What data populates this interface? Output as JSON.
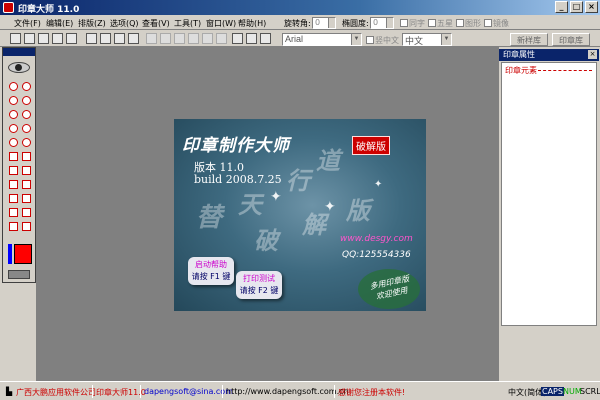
{
  "window": {
    "title": "印章大师 11.0",
    "buttons": [
      "_",
      "□",
      "×"
    ]
  },
  "menu": {
    "items": [
      "文件(F)",
      "编辑(E)",
      "排版(Z)",
      "选项(Q)",
      "查看(V)",
      "工具(T)",
      "窗口(W)",
      "帮助(H)"
    ],
    "rotation_label": "旋转角:",
    "rotation_value": "0",
    "ellipse_label": "椭圆度:",
    "ellipse_value": "0",
    "checkboxes": [
      "同字",
      "五星",
      "图形",
      "镜像"
    ]
  },
  "toolbar": {
    "font_value": "Arial",
    "font_checkbox": "竖中文",
    "lang_value": "中文",
    "panel_tabs": [
      "新样库",
      "印章库"
    ]
  },
  "right_panel": {
    "header": "印章属性",
    "close": "×",
    "title": "印章元素"
  },
  "splash": {
    "title": "印章制作大师",
    "badge": "破解版",
    "version": "版本 11.0",
    "build": "build 2008.7.25",
    "deco": [
      "替",
      "天",
      "行",
      "道",
      "破",
      "解",
      "版"
    ],
    "url": "www.desgy.com",
    "qq": "QQ:125554336",
    "help_button": {
      "line1": "启动帮助",
      "line2": "请按 F1 键"
    },
    "print_button": {
      "line1": "打印测试",
      "line2": "请按 F2 键"
    },
    "stamp": [
      "多用印章版",
      "欢迎使用"
    ]
  },
  "status": {
    "company": "广西大鹏应用软件公司",
    "product": "印章大师11.0",
    "email": "dapengsoft@sina.com",
    "website": "http://www.dapengsoft.com.cn",
    "register": "感谢您注册本软件!",
    "ime": "中文(简体)",
    "caps": "CAPS",
    "num": "NUM",
    "scrl": "SCRL"
  },
  "colors": {
    "accent": "#0a246a",
    "current_color": "#ff0000"
  }
}
